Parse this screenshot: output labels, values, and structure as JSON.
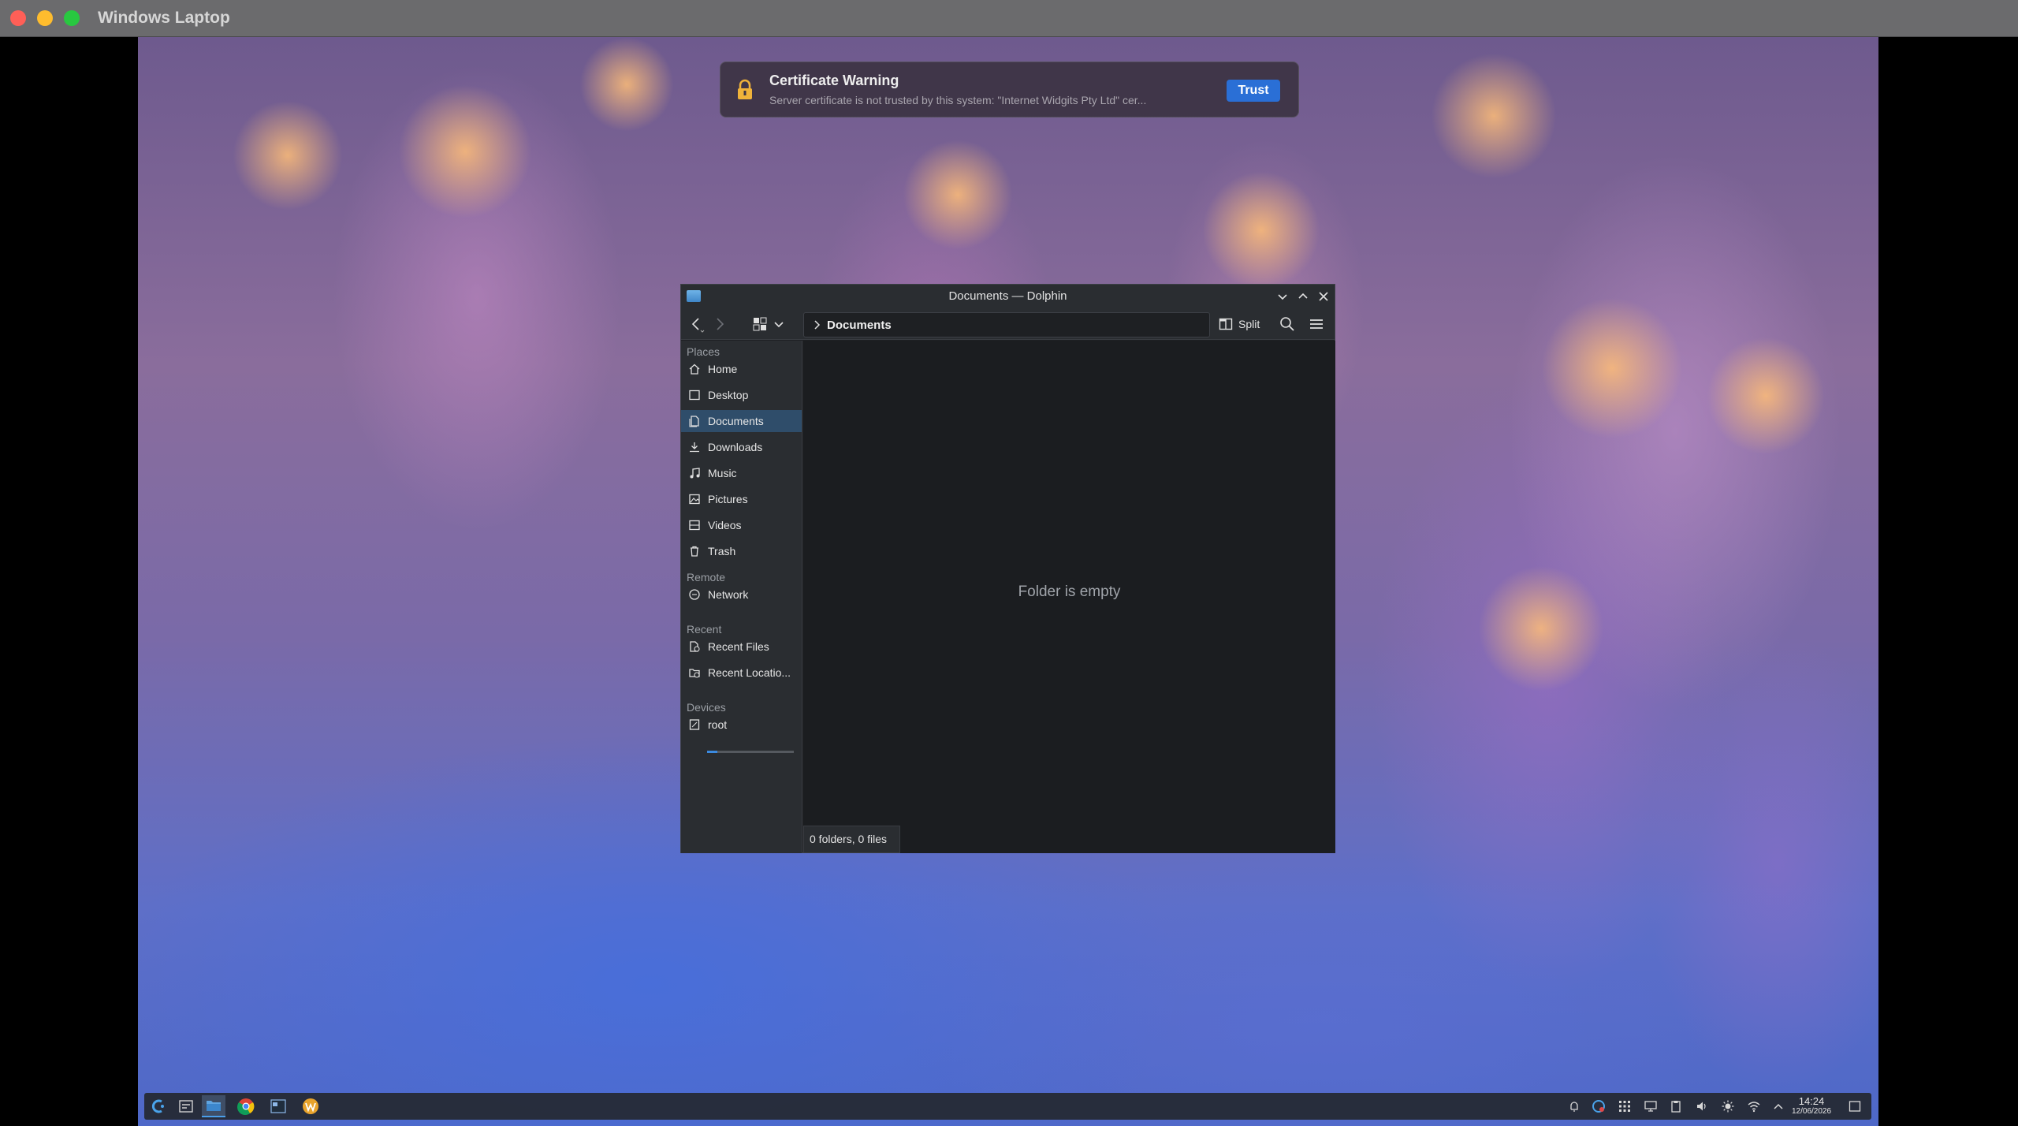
{
  "host": {
    "title": "Windows Laptop"
  },
  "notification": {
    "title": "Certificate Warning",
    "body": "Server certificate is not trusted by this system: \"Internet Widgits Pty Ltd\" cer...",
    "button": "Trust"
  },
  "dolphin": {
    "title": "Documents — Dolphin",
    "breadcrumb": "Documents",
    "split_label": "Split",
    "sidebar": {
      "sections": {
        "places": "Places",
        "remote": "Remote",
        "recent": "Recent",
        "devices": "Devices"
      },
      "places": [
        "Home",
        "Desktop",
        "Documents",
        "Downloads",
        "Music",
        "Pictures",
        "Videos",
        "Trash"
      ],
      "remote": [
        "Network"
      ],
      "recent": [
        "Recent Files",
        "Recent Locatio..."
      ],
      "devices": [
        "root"
      ],
      "selected": "Documents",
      "root_usage_fraction": 0.12
    },
    "empty_text": "Folder is empty",
    "status": "0 folders, 0 files"
  },
  "taskbar": {
    "apps": [
      "app-launcher-icon",
      "task-switcher-icon",
      "dolphin-icon",
      "chrome-icon",
      "terminal-icon",
      "w-app-icon"
    ],
    "active_app": "dolphin-icon",
    "clock": {
      "time": "14:24",
      "date": "12/06/2026"
    }
  },
  "colors": {
    "accent": "#2a6fd6",
    "selection": "#2f4d6a"
  }
}
